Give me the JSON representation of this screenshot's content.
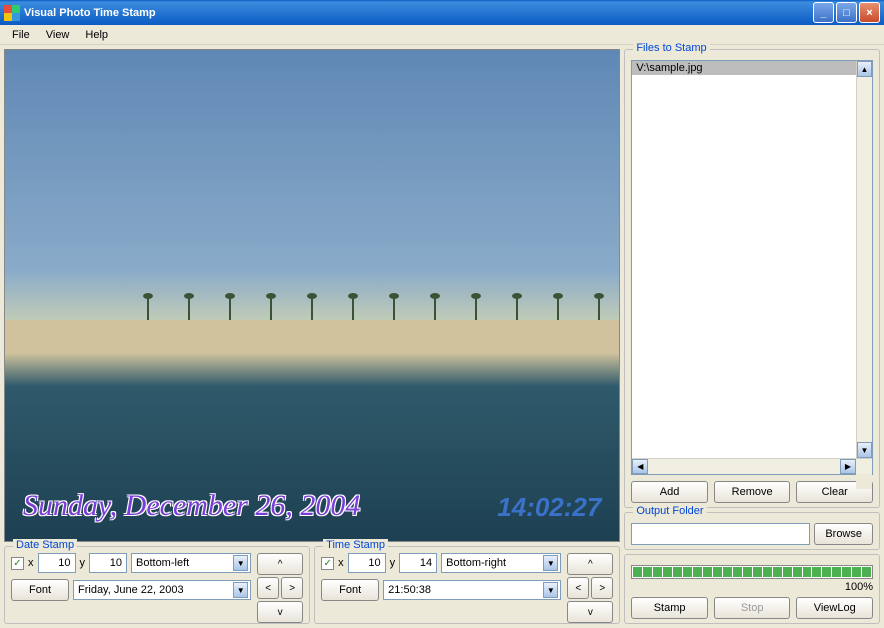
{
  "window": {
    "title": "Visual Photo Time Stamp"
  },
  "menu": {
    "file": "File",
    "view": "View",
    "help": "Help"
  },
  "preview": {
    "date_overlay": "Sunday, December 26, 2004",
    "time_overlay": "14:02:27"
  },
  "date_stamp": {
    "legend": "Date Stamp",
    "enabled": true,
    "x_label": "x",
    "x": "10",
    "y_label": "y",
    "y": "10",
    "position": "Bottom-left",
    "font_btn": "Font",
    "format": "Friday, June 22, 2003",
    "up": "^",
    "left": "<",
    "right": ">",
    "down": "v"
  },
  "time_stamp": {
    "legend": "Time Stamp",
    "enabled": true,
    "x_label": "x",
    "x": "10",
    "y_label": "y",
    "y": "14",
    "position": "Bottom-right",
    "font_btn": "Font",
    "format": "21:50:38",
    "up": "^",
    "left": "<",
    "right": ">",
    "down": "v"
  },
  "files": {
    "legend": "Files to Stamp",
    "items": [
      "V:\\sample.jpg"
    ],
    "add": "Add",
    "remove": "Remove",
    "clear": "Clear"
  },
  "output": {
    "legend": "Output Folder",
    "path": "",
    "browse": "Browse"
  },
  "progress": {
    "percent": "100%"
  },
  "actions": {
    "stamp": "Stamp",
    "stop": "Stop",
    "viewlog": "ViewLog"
  }
}
